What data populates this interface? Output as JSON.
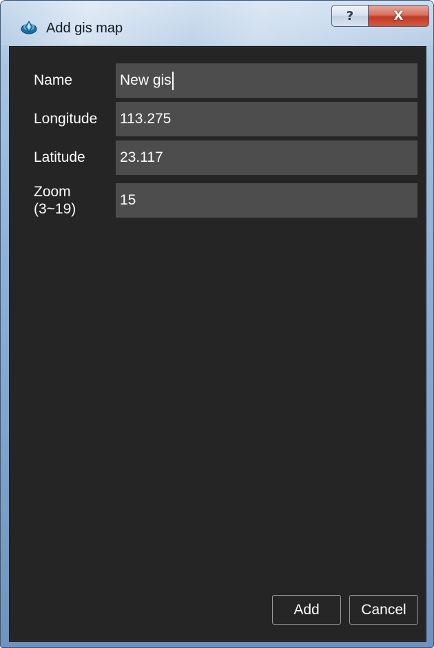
{
  "window": {
    "title": "Add gis map",
    "help_label": "?",
    "close_label": "X"
  },
  "form": {
    "name": {
      "label": "Name",
      "value": "New gis"
    },
    "longitude": {
      "label": "Longitude",
      "value": "113.275"
    },
    "latitude": {
      "label": "Latitude",
      "value": "23.117"
    },
    "zoom": {
      "label_line1": "Zoom",
      "label_line2": "(3~19)",
      "value": "15"
    }
  },
  "buttons": {
    "add_label": "Add",
    "cancel_label": "Cancel"
  },
  "icons": {
    "title": "map-app-icon",
    "help": "question-mark-icon",
    "close": "close-x-icon"
  },
  "colors": {
    "client_background": "#252525",
    "input_background": "#4d4d4d",
    "text": "#ffffff",
    "close_button": "#c13a24"
  }
}
